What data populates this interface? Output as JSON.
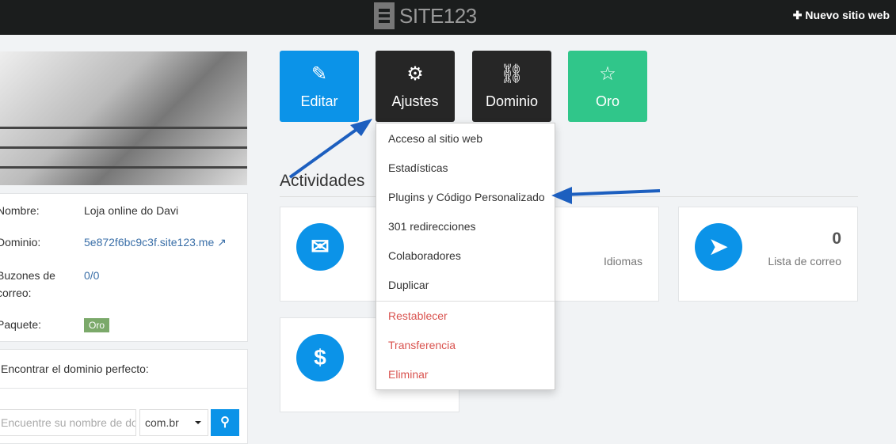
{
  "header": {
    "logo": "SITE123",
    "new_site": "Nuevo sitio web"
  },
  "toolbar": [
    {
      "label": "Editar",
      "icon": "edit-icon",
      "color": "#0b93e8"
    },
    {
      "label": "Ajustes",
      "icon": "gear-icon",
      "color": "#262626"
    },
    {
      "label": "Dominio",
      "icon": "link-icon",
      "color": "#262626"
    },
    {
      "label": "Oro",
      "icon": "star-icon",
      "color": "#30c68a"
    }
  ],
  "settings_menu": {
    "items": [
      "Acceso al sitio web",
      "Estadísticas",
      "Plugins y Código Personalizado",
      "301 redirecciones",
      "Colaboradores",
      "Duplicar"
    ],
    "danger_items": [
      "Restablecer",
      "Transferencia",
      "Eliminar"
    ]
  },
  "site_info": {
    "name_label": "Nombre:",
    "name": "Loja online do Davi",
    "domain_label": "Dominio:",
    "domain": "5e872f6bc9c3f.site123.me",
    "mailboxes_label": "Buzones de correo:",
    "mailboxes": "0/0",
    "package_label": "Paquete:",
    "package": "Oro"
  },
  "domain_search": {
    "title": "Encontrar el dominio perfecto:",
    "placeholder": "Encuentre su nombre de dominio",
    "tld": "com.br"
  },
  "activities": {
    "title": "Actividades",
    "cards": [
      {
        "label": "Idiomas",
        "icon": "envelope-icon"
      },
      {
        "value": "0",
        "label": "Lista de correo",
        "icon": "paper-plane-icon"
      },
      {
        "icon": "dollar-icon"
      }
    ]
  }
}
